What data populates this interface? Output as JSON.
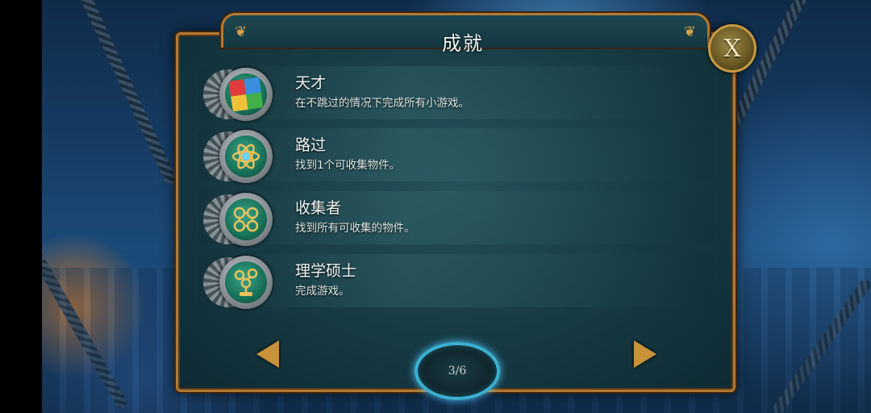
{
  "panel": {
    "title": "成就",
    "close_label": "X"
  },
  "achievements": [
    {
      "name": "天才",
      "description": "在不跳过的情况下完成所有小游戏。",
      "icon": "puzzle-icon"
    },
    {
      "name": "路过",
      "description": "找到1个可收集物件。",
      "icon": "atom-icon"
    },
    {
      "name": "收集者",
      "description": "找到所有可收集的物件。",
      "icon": "molecules-icon"
    },
    {
      "name": "理学硕士",
      "description": "完成游戏。",
      "icon": "trophy-icon"
    }
  ],
  "pager": {
    "page": "3/6"
  },
  "colors": {
    "frame": "#b27a34",
    "panel": "#163a44",
    "accent": "#3bb0d0"
  }
}
